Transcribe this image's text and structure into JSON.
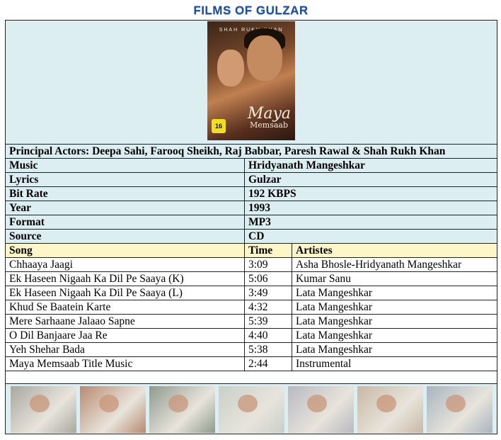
{
  "header": {
    "title": "FILMS OF GULZAR"
  },
  "poster": {
    "actor": "SHAH RUKH KHAN",
    "title": "Maya",
    "subtitle": "Memsaab",
    "rating": "16"
  },
  "principal_actors": "Principal Actors: Deepa Sahi, Farooq Sheikh, Raj Babbar, Paresh Rawal & Shah Rukh Khan",
  "info": [
    {
      "label": "Music",
      "value": "Hridyanath Mangeshkar"
    },
    {
      "label": "Lyrics",
      "value": "Gulzar"
    },
    {
      "label": "Bit Rate",
      "value": "192 KBPS"
    },
    {
      "label": "Year",
      "value": "1993"
    },
    {
      "label": "Format",
      "value": "MP3"
    },
    {
      "label": "Source",
      "value": "CD"
    }
  ],
  "songs_header": {
    "song": "Song",
    "time": "Time",
    "artistes": "Artistes"
  },
  "songs": [
    {
      "song": "Chhaaya Jaagi",
      "time": "3:09",
      "artistes": "Asha Bhosle-Hridyanath Mangeshkar"
    },
    {
      "song": "Ek Haseen Nigaah Ka Dil Pe Saaya (K)",
      "time": "5:06",
      "artistes": "Kumar Sanu"
    },
    {
      "song": "Ek Haseen Nigaah Ka Dil Pe Saaya (L)",
      "time": "3:49",
      "artistes": "Lata Mangeshkar"
    },
    {
      "song": "Khud Se Baatein Karte",
      "time": "4:32",
      "artistes": "Lata Mangeshkar"
    },
    {
      "song": "Mere Sarhaane Jalaao Sapne",
      "time": "5:39",
      "artistes": "Lata Mangeshkar"
    },
    {
      "song": "O Dil Banjaare Jaa Re",
      "time": "4:40",
      "artistes": "Lata Mangeshkar"
    },
    {
      "song": "Yeh Shehar Bada",
      "time": "5:38",
      "artistes": "Lata Mangeshkar"
    },
    {
      "song": "Maya Memsaab Title Music",
      "time": "2:44",
      "artistes": "Instrumental"
    }
  ],
  "thumbnail_colors": [
    "#a8a8a0",
    "#b88a70",
    "#8f9a8c",
    "#c8d0c8",
    "#b8b8c0",
    "#c9b8a4",
    "#a8b4c0"
  ]
}
